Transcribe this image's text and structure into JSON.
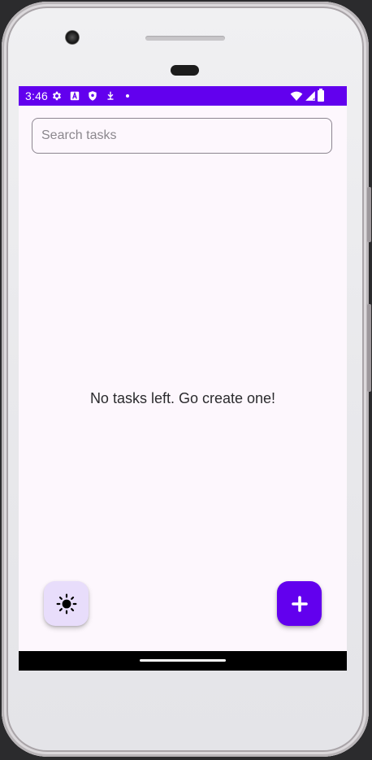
{
  "status_bar": {
    "time": "3:46",
    "background_color": "#6200ee",
    "left_icons": [
      "settings-gear-icon",
      "font-a-icon",
      "shield-icon",
      "download-icon",
      "dot-icon"
    ],
    "right_icons": [
      "wifi-icon",
      "cell-signal-icon",
      "battery-icon"
    ]
  },
  "search": {
    "placeholder": "Search tasks",
    "value": ""
  },
  "main": {
    "empty_message": "No tasks left. Go create one!"
  },
  "fabs": {
    "theme_toggle_icon": "sun-icon",
    "theme_toggle_color": "#e8ddfb",
    "add_task_icon": "plus-icon",
    "add_task_color": "#6200ee"
  },
  "colors": {
    "accent": "#6200ee",
    "screen_background": "#fdf7fd",
    "nav_bar": "#000000"
  }
}
